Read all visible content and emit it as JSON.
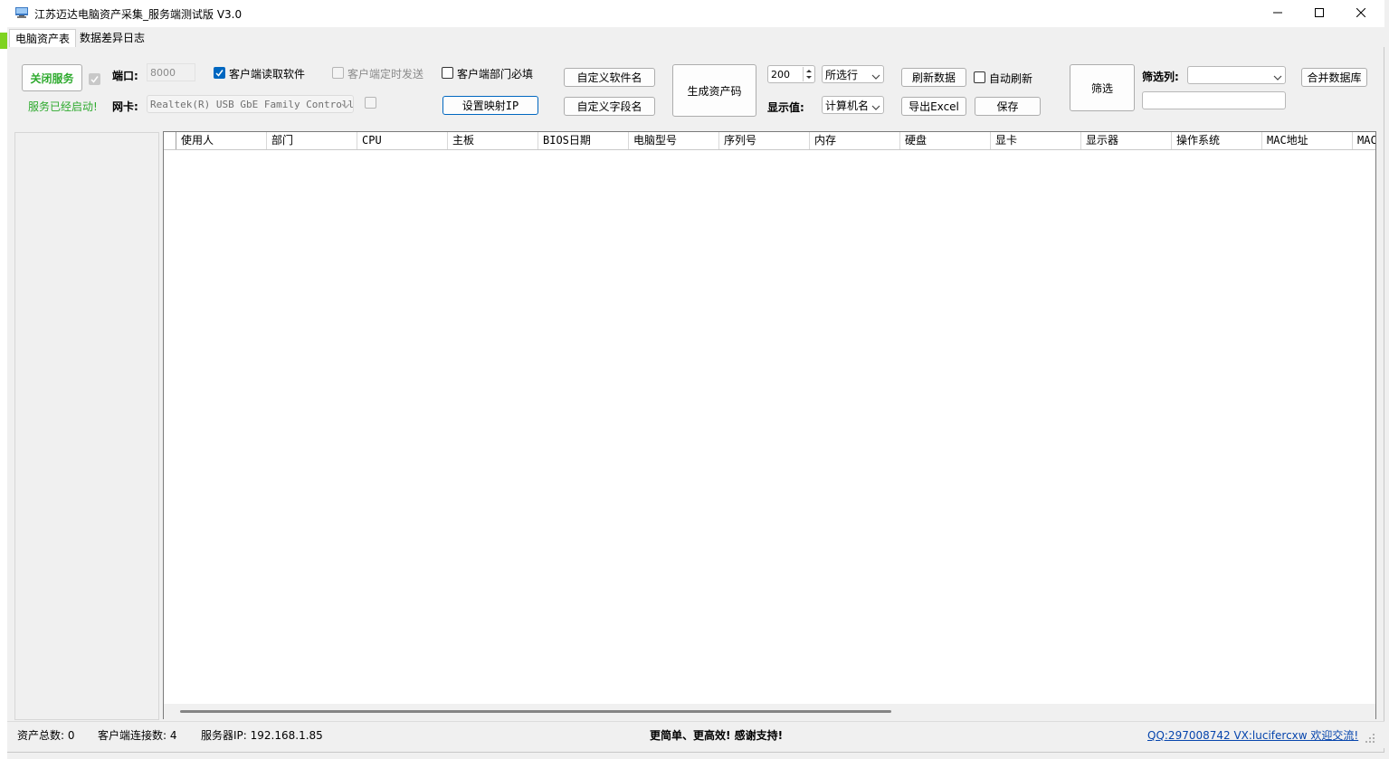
{
  "window": {
    "title": "江苏迈达电脑资产采集_服务端测试版 V3.0",
    "minimize_icon": "minimize-icon",
    "maximize_icon": "maximize-icon",
    "close_icon": "close-icon"
  },
  "tabs": [
    {
      "label": "电脑资产表",
      "active": true
    },
    {
      "label": "数据差异日志",
      "active": false
    }
  ],
  "toolbar": {
    "stop_service_label": "关闭服务",
    "service_status": "服务已经启动!",
    "service_status_color": "#2eaa2e",
    "port_label": "端口:",
    "port_value": "8000",
    "nic_label": "网卡:",
    "nic_value": "Realtek(R) USB GbE Family Controll",
    "client_read_software_label": "客户端读取软件",
    "client_read_software_checked": true,
    "client_timed_send_label": "客户端定时发送",
    "client_timed_send_checked": false,
    "client_dept_required_label": "客户端部门必填",
    "client_dept_required_checked": false,
    "set_mapping_ip_label": "设置映射IP",
    "custom_software_name_label": "自定义软件名",
    "custom_field_name_label": "自定义字段名",
    "generate_asset_code_label": "生成资产码",
    "count_value": "200",
    "row_select_value": "所选行",
    "display_value_label": "显示值:",
    "display_value_select": "计算机名",
    "refresh_data_label": "刷新数据",
    "auto_refresh_label": "自动刷新",
    "auto_refresh_checked": false,
    "export_excel_label": "导出Excel",
    "save_label": "保存",
    "filter_button_label": "筛选",
    "filter_column_label": "筛选列:",
    "filter_column_value": "",
    "filter_text_value": "",
    "merge_db_label": "合并数据库"
  },
  "grid": {
    "columns": [
      "使用人",
      "部门",
      "CPU",
      "主板",
      "BIOS日期",
      "电脑型号",
      "序列号",
      "内存",
      "硬盘",
      "显卡",
      "显示器",
      "操作系统",
      "MAC地址",
      "MAC"
    ],
    "rows": []
  },
  "status": {
    "asset_total": "资产总数: 0",
    "client_connections": "客户端连接数: 4",
    "server_ip": "服务器IP: 192.168.1.85",
    "slogan": "更简单、更高效! 感谢支持!",
    "contact_link": "QQ:297008742  VX:lucifercxw 欢迎交流!"
  },
  "colors": {
    "accent": "#0067c0",
    "success_green": "#2eaa2e",
    "link_blue": "#0645ad"
  }
}
